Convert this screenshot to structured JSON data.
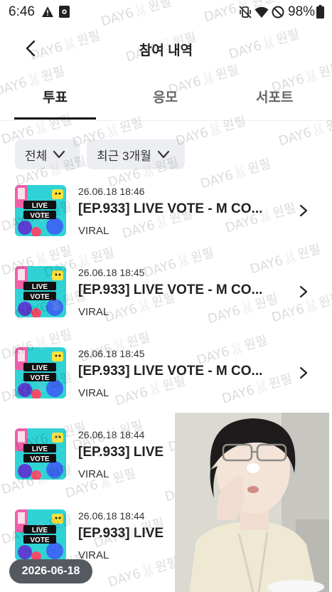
{
  "status_bar": {
    "time": "6:46",
    "battery": "98%"
  },
  "header": {
    "title": "참여 내역"
  },
  "tabs": [
    {
      "label": "투표",
      "active": true
    },
    {
      "label": "응모",
      "active": false
    },
    {
      "label": "서포트",
      "active": false
    }
  ],
  "filters": {
    "type": "전체",
    "period": "최근 3개월"
  },
  "items": [
    {
      "date": "26.06.18 18:46",
      "title": "[EP.933] LIVE VOTE - M CO...",
      "source": "VIRAL"
    },
    {
      "date": "26.06.18 18:45",
      "title": "[EP.933] LIVE VOTE - M CO...",
      "source": "VIRAL"
    },
    {
      "date": "26.06.18 18:45",
      "title": "[EP.933] LIVE VOTE - M CO...",
      "source": "VIRAL"
    },
    {
      "date": "26.06.18 18:44",
      "title": "[EP.933] LIVE",
      "source": "VIRAL"
    },
    {
      "date": "26.06.18 18:44",
      "title": "[EP.933] LIVE",
      "source": "VIRAL"
    }
  ],
  "thumbnail_text": {
    "line1": "LIVE",
    "line2": "VOTE"
  },
  "watermark_text": "DAY6🐰원필",
  "date_pill": "2026-06-18",
  "colors": {
    "tab_indicator": "#111111",
    "chip_bg": "#eceef2",
    "date_pill_bg": "#555a61",
    "thumb_bg": "#2fd3d6"
  }
}
